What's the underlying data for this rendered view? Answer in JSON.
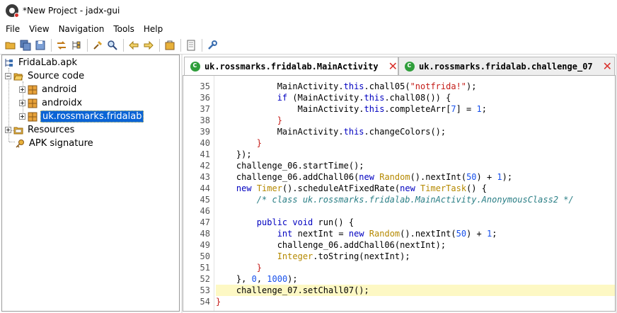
{
  "window": {
    "title": "*New Project - jadx-gui"
  },
  "menu": [
    "File",
    "View",
    "Navigation",
    "Tools",
    "Help"
  ],
  "toolbar_icons": [
    "open-folder-icon",
    "save-all-icon",
    "export-icon",
    "sync-icon",
    "flatten-icon",
    "search-icon",
    "find-icon",
    "back-icon",
    "forward-icon",
    "deobfuscate-icon",
    "log-icon",
    "preferences-icon"
  ],
  "tree": {
    "root": "FridaLab.apk",
    "source_code": "Source code",
    "packages": [
      "android",
      "androidx",
      "uk.rossmarks.fridalab"
    ],
    "resources": "Resources",
    "apk_signature": "APK signature"
  },
  "tabs": [
    {
      "label": "uk.rossmarks.fridalab.MainActivity",
      "active": true
    },
    {
      "label": "uk.rossmarks.fridalab.challenge_07",
      "active": false
    }
  ],
  "code_lines": [
    {
      "n": "35",
      "tokens": [
        [
          "",
          "            MainActivity."
        ],
        [
          "kw",
          "this"
        ],
        [
          "",
          ".chall05("
        ],
        [
          "str",
          "\"notfrida!\""
        ],
        [
          "",
          ");"
        ]
      ]
    },
    {
      "n": "36",
      "tokens": [
        [
          "",
          "            "
        ],
        [
          "kw",
          "if"
        ],
        [
          "",
          " (MainActivity."
        ],
        [
          "kw",
          "this"
        ],
        [
          "",
          ".chall08()) {"
        ]
      ]
    },
    {
      "n": "37",
      "tokens": [
        [
          "",
          "                MainActivity."
        ],
        [
          "kw",
          "this"
        ],
        [
          "",
          ".completeArr["
        ],
        [
          "num",
          "7"
        ],
        [
          "",
          "] = "
        ],
        [
          "num",
          "1"
        ],
        [
          "",
          ";"
        ]
      ]
    },
    {
      "n": "38",
      "tokens": [
        [
          "br",
          "            }"
        ]
      ]
    },
    {
      "n": "39",
      "tokens": [
        [
          "",
          "            MainActivity."
        ],
        [
          "kw",
          "this"
        ],
        [
          "",
          ".changeColors();"
        ]
      ]
    },
    {
      "n": "40",
      "tokens": [
        [
          "br",
          "        }"
        ]
      ]
    },
    {
      "n": "41",
      "tokens": [
        [
          "",
          "    });"
        ]
      ]
    },
    {
      "n": "42",
      "tokens": [
        [
          "",
          "    challenge_06.startTime();"
        ]
      ]
    },
    {
      "n": "43",
      "tokens": [
        [
          "",
          "    challenge_06.addChall06("
        ],
        [
          "kw",
          "new"
        ],
        [
          "",
          " "
        ],
        [
          "cls",
          "Random"
        ],
        [
          "",
          "().nextInt("
        ],
        [
          "num",
          "50"
        ],
        [
          "",
          ") + "
        ],
        [
          "num",
          "1"
        ],
        [
          "",
          ");"
        ]
      ]
    },
    {
      "n": "44",
      "tokens": [
        [
          "",
          "    "
        ],
        [
          "kw",
          "new"
        ],
        [
          "",
          " "
        ],
        [
          "cls",
          "Timer"
        ],
        [
          "",
          "().scheduleAtFixedRate("
        ],
        [
          "kw",
          "new"
        ],
        [
          "",
          " "
        ],
        [
          "cls",
          "TimerTask"
        ],
        [
          "",
          "() {"
        ]
      ]
    },
    {
      "n": "45",
      "tokens": [
        [
          "cmt",
          "        /* class uk.rossmarks.fridalab.MainActivity.AnonymousClass2 */"
        ]
      ]
    },
    {
      "n": "46",
      "tokens": []
    },
    {
      "n": "47",
      "tokens": [
        [
          "",
          "        "
        ],
        [
          "kw",
          "public void"
        ],
        [
          "",
          " run() {"
        ]
      ]
    },
    {
      "n": "48",
      "tokens": [
        [
          "",
          "            "
        ],
        [
          "kw",
          "int"
        ],
        [
          "",
          " nextInt = "
        ],
        [
          "kw",
          "new"
        ],
        [
          "",
          " "
        ],
        [
          "cls",
          "Random"
        ],
        [
          "",
          "().nextInt("
        ],
        [
          "num",
          "50"
        ],
        [
          "",
          ") + "
        ],
        [
          "num",
          "1"
        ],
        [
          "",
          ";"
        ]
      ]
    },
    {
      "n": "49",
      "tokens": [
        [
          "",
          "            challenge_06.addChall06(nextInt);"
        ]
      ]
    },
    {
      "n": "50",
      "tokens": [
        [
          "",
          "            "
        ],
        [
          "cls",
          "Integer"
        ],
        [
          "",
          ".toString(nextInt);"
        ]
      ]
    },
    {
      "n": "51",
      "tokens": [
        [
          "br",
          "        }"
        ]
      ]
    },
    {
      "n": "52",
      "tokens": [
        [
          "",
          "    }, "
        ],
        [
          "num",
          "0"
        ],
        [
          "",
          ", "
        ],
        [
          "num",
          "1000"
        ],
        [
          "",
          ");"
        ]
      ]
    },
    {
      "n": "53",
      "tokens": [
        [
          "",
          "    challenge_07.setChall07();"
        ]
      ],
      "highlight": true
    },
    {
      "n": "54",
      "tokens": [
        [
          "br",
          "}"
        ]
      ]
    }
  ],
  "colors": {
    "selection": "#0a64d6",
    "line_highlight": "#fdf8c4",
    "keyword": "#0000c0",
    "close": "#d9302b"
  }
}
